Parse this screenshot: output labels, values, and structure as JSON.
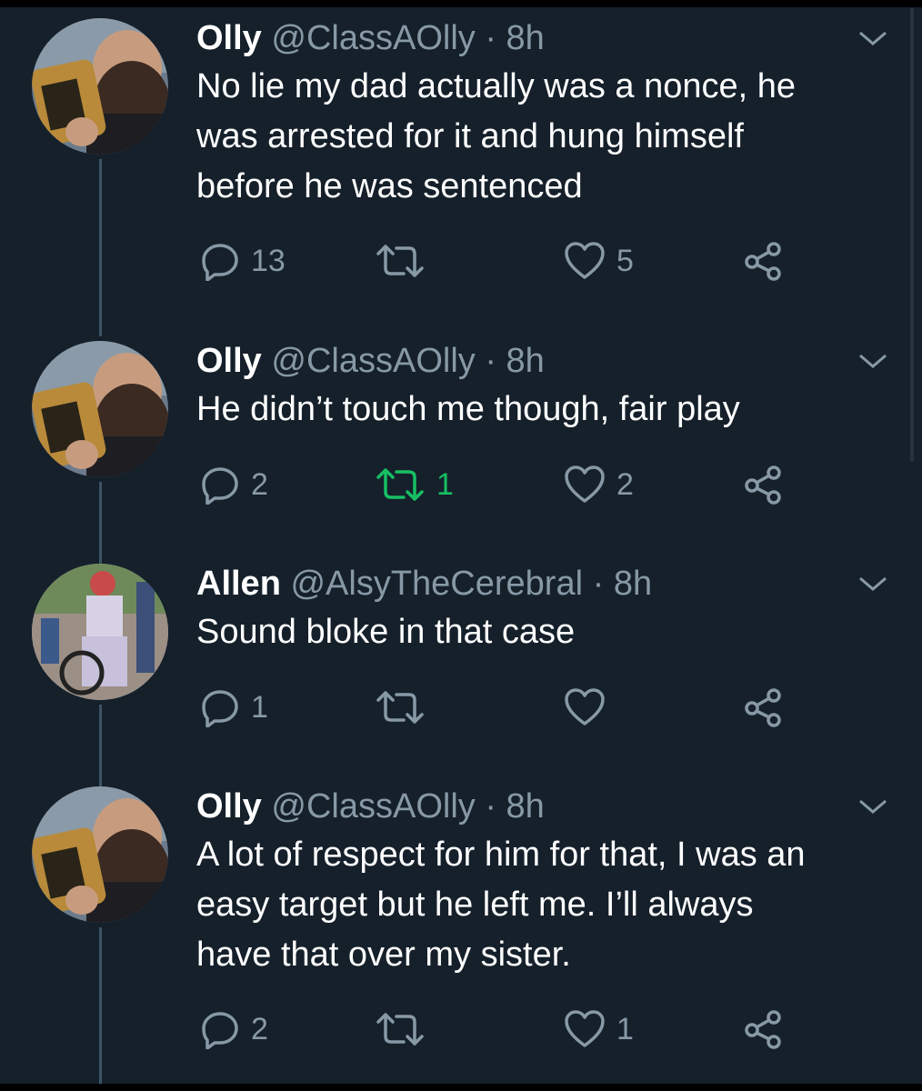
{
  "colors": {
    "background": "#15202b",
    "text": "#ffffff",
    "muted": "#8899a6",
    "retweet_active": "#17bf63",
    "thread_line": "#3d5466"
  },
  "tweets": [
    {
      "name": "Olly",
      "handle": "@ClassAOlly",
      "time": "· 8h",
      "lines": [
        "No lie my dad actually was a nonce, he",
        "was arrested for it and hung himself",
        "before he was sentenced"
      ],
      "replies": "13",
      "retweets": "",
      "likes": "5",
      "avatar": "bearded-man-drinking-avatar"
    },
    {
      "name": "Olly",
      "handle": "@ClassAOlly",
      "time": "· 8h",
      "lines": [
        "He didn’t touch me though, fair play"
      ],
      "replies": "2",
      "retweets": "1",
      "retweeted": true,
      "likes": "2",
      "avatar": "bearded-man-drinking-avatar"
    },
    {
      "name": "Allen",
      "handle": "@AlsyTheCerebral",
      "time": "· 8h",
      "lines": [
        "Sound bloke in that case"
      ],
      "replies": "1",
      "retweets": "",
      "likes": "",
      "avatar": "person-in-wheelchair-avatar"
    },
    {
      "name": "Olly",
      "handle": "@ClassAOlly",
      "time": "· 8h",
      "lines": [
        "A lot of respect for him for that, I was an",
        "easy target but he left me. I’ll always",
        "have that over my sister."
      ],
      "replies": "2",
      "retweets": "",
      "likes": "1",
      "avatar": "bearded-man-drinking-avatar"
    }
  ],
  "icons": {
    "reply": "reply-icon",
    "retweet": "retweet-icon",
    "like": "heart-icon",
    "share": "share-icon",
    "menu": "chevron-down-icon"
  }
}
